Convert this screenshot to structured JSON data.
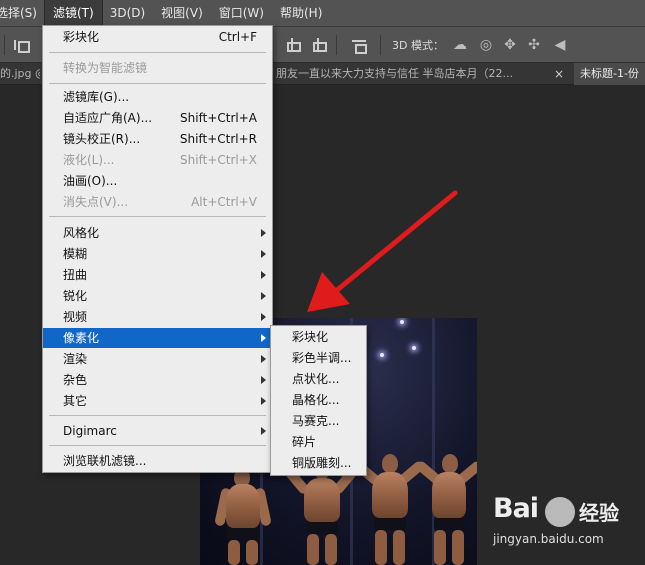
{
  "menubar": {
    "items": [
      "选择(S)",
      "滤镜(T)",
      "3D(D)",
      "视图(V)",
      "窗口(W)",
      "帮助(H)"
    ],
    "active_index": 1
  },
  "options_bar": {
    "mode_label": "3D 模式："
  },
  "doc_tabs": {
    "tab1": "的.jpg @",
    "tab2": "朋友一直以来大力支持与信任 半岛店本月（22...",
    "tab3": "未标题-1-份",
    "close_symbol": "×"
  },
  "filter_menu": {
    "items": [
      {
        "label": "彩块化",
        "shortcut": "Ctrl+F",
        "disabled": false
      },
      {
        "label": "转换为智能滤镜",
        "shortcut": "",
        "disabled": true
      },
      {
        "label": "滤镜库(G)...",
        "shortcut": "",
        "disabled": false
      },
      {
        "label": "自适应广角(A)...",
        "shortcut": "Shift+Ctrl+A",
        "disabled": false
      },
      {
        "label": "镜头校正(R)...",
        "shortcut": "Shift+Ctrl+R",
        "disabled": false
      },
      {
        "label": "液化(L)...",
        "shortcut": "Shift+Ctrl+X",
        "disabled": true
      },
      {
        "label": "油画(O)...",
        "shortcut": "",
        "disabled": false
      },
      {
        "label": "消失点(V)...",
        "shortcut": "Alt+Ctrl+V",
        "disabled": true
      },
      {
        "label": "风格化",
        "submenu": true
      },
      {
        "label": "模糊",
        "submenu": true
      },
      {
        "label": "扭曲",
        "submenu": true
      },
      {
        "label": "锐化",
        "submenu": true
      },
      {
        "label": "视频",
        "submenu": true
      },
      {
        "label": "像素化",
        "submenu": true,
        "highlighted": true
      },
      {
        "label": "渲染",
        "submenu": true
      },
      {
        "label": "杂色",
        "submenu": true
      },
      {
        "label": "其它",
        "submenu": true
      },
      {
        "label": "Digimarc",
        "submenu": true
      },
      {
        "label": "浏览联机滤镜...",
        "shortcut": "",
        "disabled": false
      }
    ]
  },
  "pixelate_submenu": {
    "items": [
      "彩块化",
      "彩色半调...",
      "点状化...",
      "晶格化...",
      "马赛克...",
      "碎片",
      "铜版雕刻..."
    ]
  },
  "watermark": {
    "brand": "Bai",
    "brand_suffix": "经验",
    "url": "jingyan.baidu.com"
  },
  "colors": {
    "menubar_bg": "#535353",
    "menu_bg": "#ededed",
    "highlight": "#1167c8",
    "arrow": "#e01b1b"
  }
}
